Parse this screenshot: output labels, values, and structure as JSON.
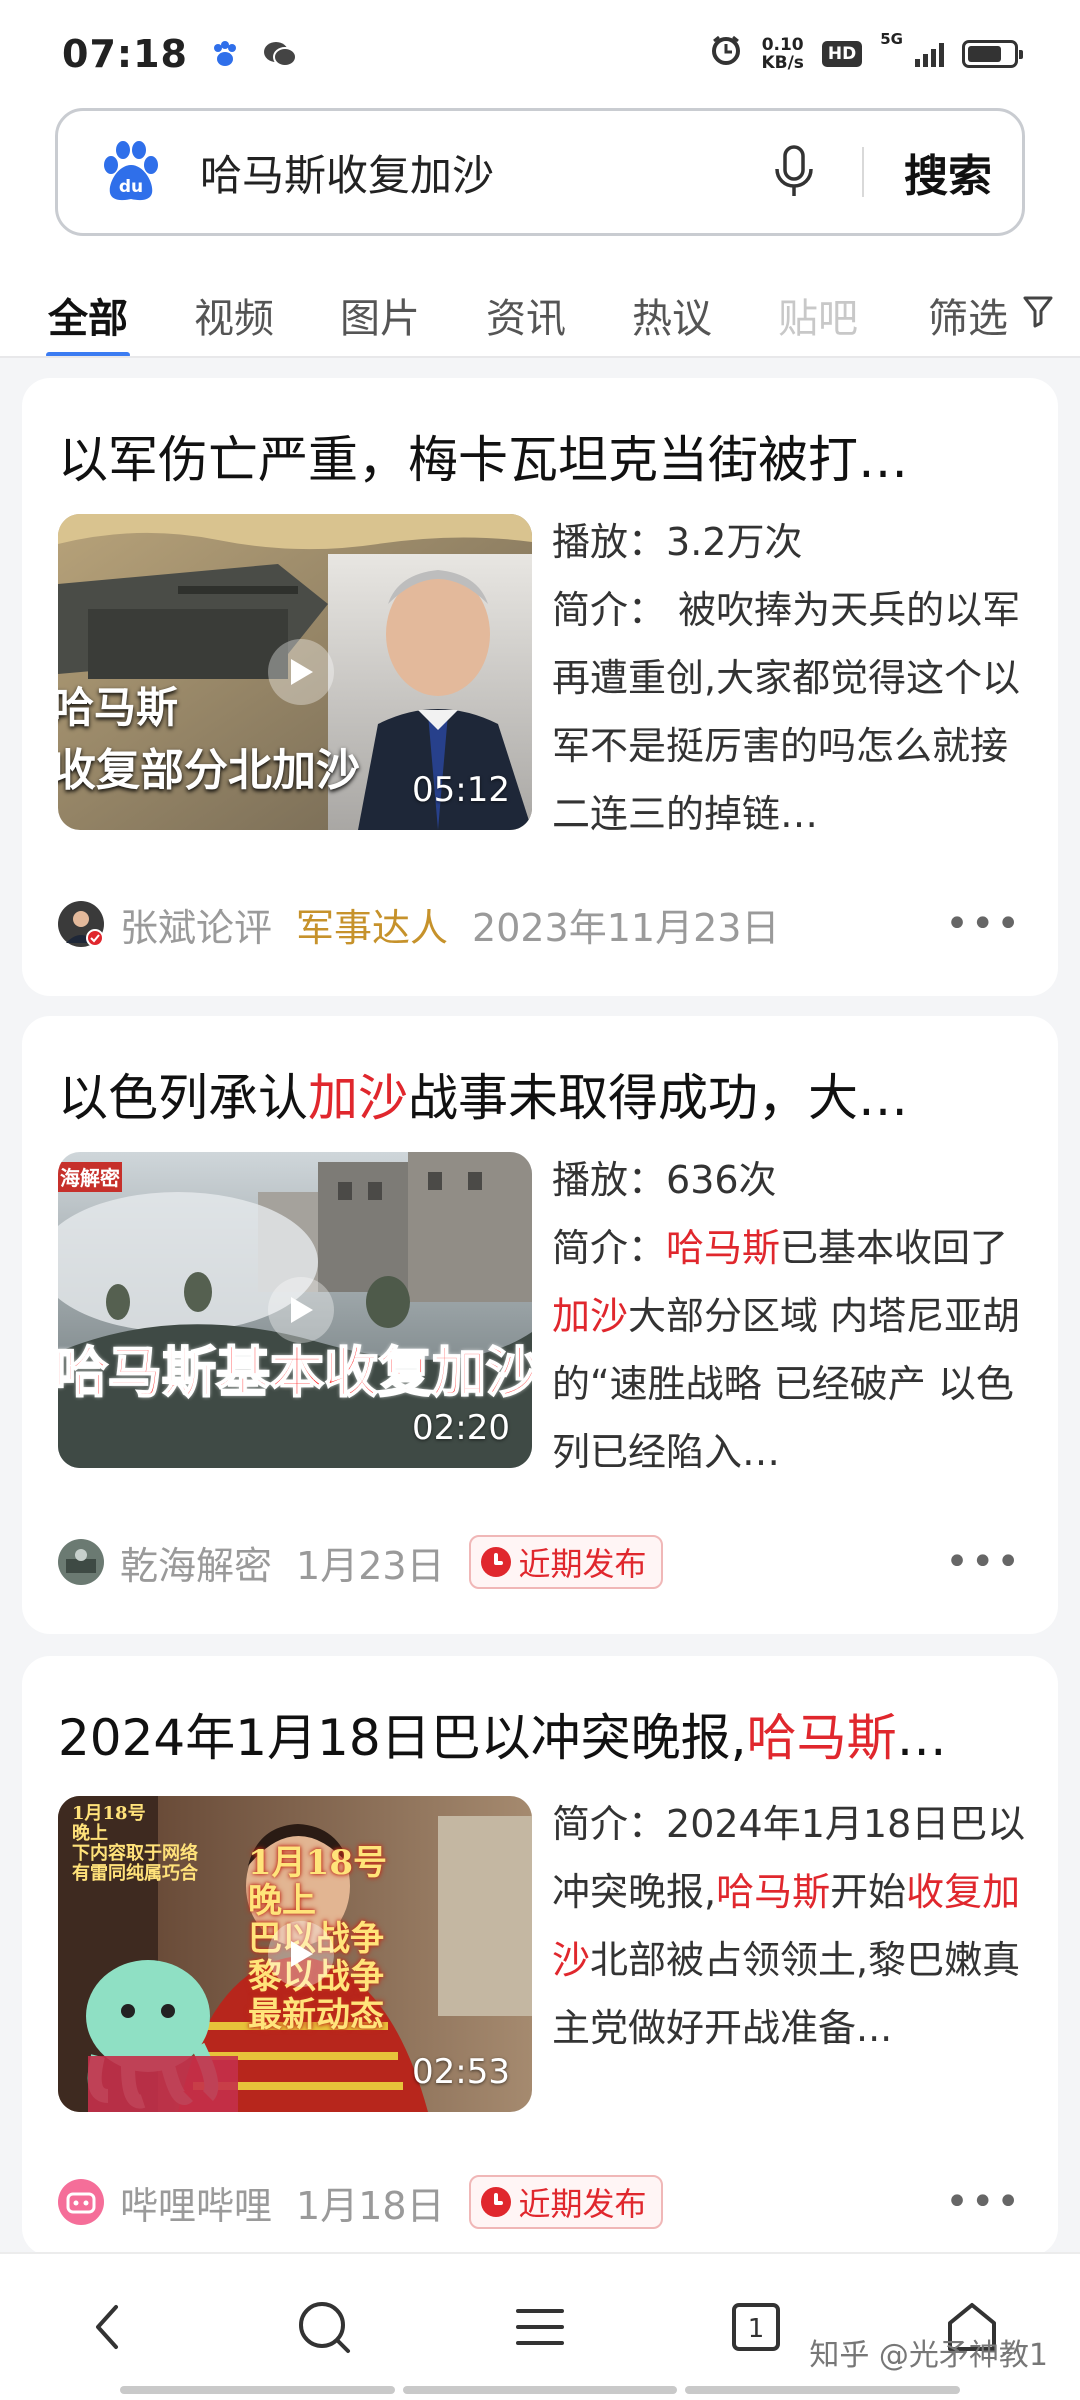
{
  "status_bar": {
    "time": "07:18",
    "net_speed_value": "0.10",
    "net_speed_unit": "KB/s",
    "hd": "HD",
    "network": "5G",
    "battery_level": 0.75
  },
  "search": {
    "query": "哈马斯收复加沙",
    "submit_label": "搜索",
    "logo_text": "du"
  },
  "tabs": [
    "全部",
    "视频",
    "图片",
    "资讯",
    "热议",
    "贴吧"
  ],
  "filter_label": "筛选",
  "results": [
    {
      "title": "以军伤亡严重，梅卡瓦坦克当街被打…",
      "plays_label": "播放：",
      "plays": "3.2万次",
      "desc_label": "简介：",
      "desc_parts": [
        " 被吹捧为天兵的以军再遭重创,大家都觉得这个以军不是挺厉害的吗怎么就接二连三的掉链…"
      ],
      "duration": "05:12",
      "thumb_text_1": "哈马斯",
      "thumb_text_2": "收复部分北加沙",
      "source": "张斌论评",
      "tag": "军事达人",
      "date": "2023年11月23日"
    },
    {
      "title_parts": [
        "以色列承认",
        "加沙",
        "战事未取得成功，大…"
      ],
      "plays_label": "播放：",
      "plays": "636次",
      "desc_label": "简介：",
      "desc_parts": [
        "哈马斯",
        "已基本收回了",
        "加沙",
        "大部分区域 内塔尼亚胡的“速胜战略 已经破产 以色列已经陷入…"
      ],
      "duration": "02:20",
      "thumb_corner": "海解密",
      "thumb_text_1": "哈马斯基本收复加沙",
      "source": "乾海解密",
      "date": "1月23日",
      "badge": "近期发布"
    },
    {
      "title_parts": [
        "2024年1月18日巴以冲突晚报,",
        "哈马斯",
        "…"
      ],
      "desc_label": "简介：",
      "desc_parts": [
        "2024年1月18日巴以冲突晚报,",
        "哈马斯",
        "开始",
        "收复加沙",
        "北部被占领领土,黎巴嫩真主党做好开战准备..."
      ],
      "duration": "02:53",
      "thumb_corner_1": "1月18号",
      "thumb_corner_2": "晚上",
      "thumb_corner_3": "下内容取于网络",
      "thumb_corner_4": "有雷同纯属巧合",
      "thumb_lines": [
        "1月18号",
        "晚上",
        "巴以战争",
        "黎以战争",
        "最新动态"
      ],
      "source": "哔哩哔哩",
      "date": "1月18日",
      "badge": "近期发布"
    }
  ],
  "watermark": "知乎 @光矛神教1",
  "colors": {
    "highlight": "#e0272d",
    "tab_indicator": "#3b7cf2",
    "tag_gold": "#c6922b"
  }
}
